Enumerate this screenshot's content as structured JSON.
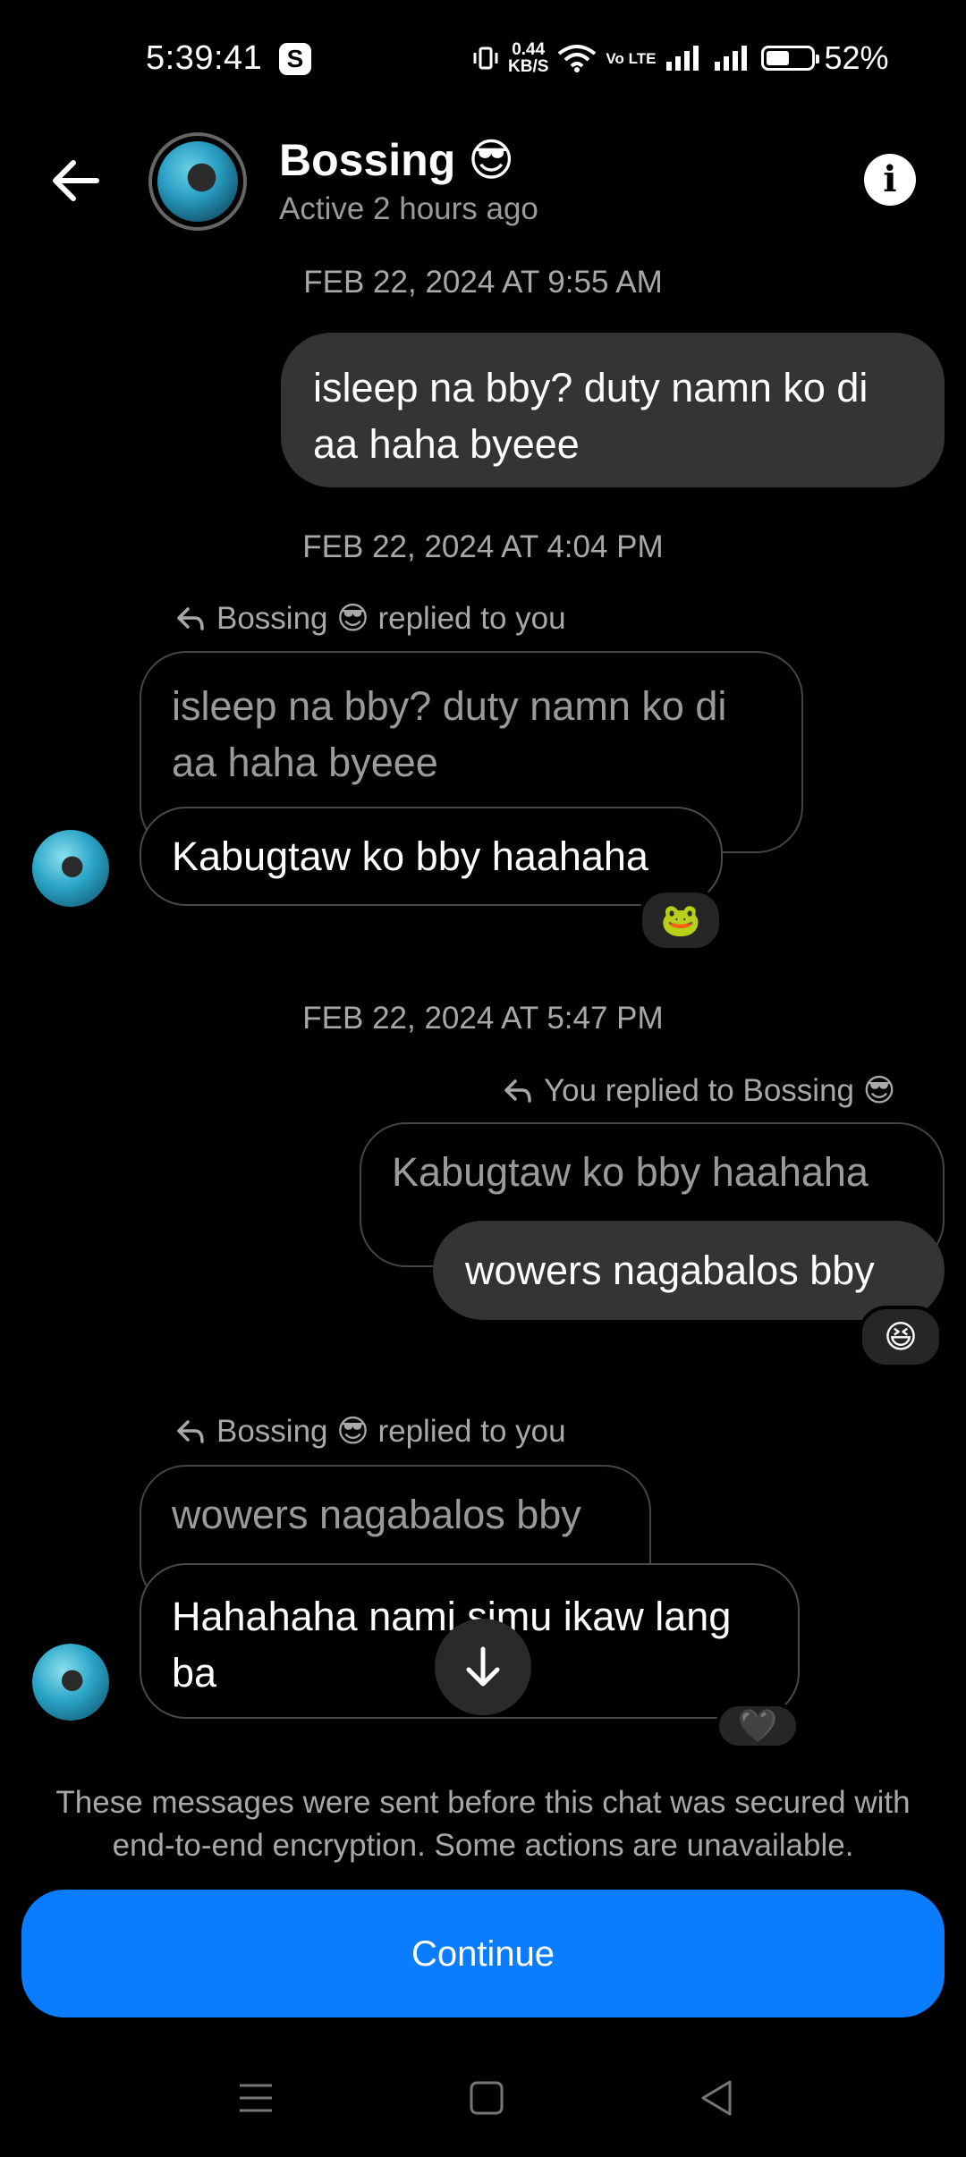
{
  "status_bar": {
    "time": "5:39:41",
    "app_icon": "S",
    "net_speed_value": "0.44",
    "net_speed_unit": "KB/S",
    "volte": "Vo LTE",
    "battery_level": 0.52,
    "battery_percent": "52%"
  },
  "header": {
    "name": "Bossing 😎",
    "status": "Active 2 hours ago",
    "info_icon": "i"
  },
  "messages": {
    "ts1": "FEB 22, 2024 AT 9:55 AM",
    "m1": "isleep na bby? duty namn ko di aa haha byeee",
    "ts2": "FEB 22, 2024 AT 4:04 PM",
    "r1_label": "Bossing 😎 replied to you",
    "r1_quote": "isleep na bby? duty namn ko di aa haha byeee",
    "r1_text": "Kabugtaw ko bby haahaha",
    "r1_reaction": "🐸",
    "ts3": "FEB 22, 2024 AT 5:47 PM",
    "r2_label": "You replied to Bossing 😎",
    "r2_quote": "Kabugtaw ko bby haahaha",
    "r2_text": "wowers nagabalos bby",
    "r2_reaction": "😆",
    "r3_label": "Bossing 😎 replied to you",
    "r3_quote": "wowers nagabalos bby",
    "r3_text": "Hahahaha nami simu ikaw lang ba",
    "r3_reaction": "🖤"
  },
  "footer": {
    "notice": "These messages were sent before this chat was secured with end-to-end encryption. Some actions are unavailable.",
    "continue_label": "Continue"
  },
  "icons": {
    "back": "arrow-left-icon",
    "scroll": "arrow-down-icon",
    "reply": "reply-arrow-icon",
    "nav_menu": "menu-icon",
    "nav_home": "square-icon",
    "nav_back": "triangle-back-icon"
  },
  "colors": {
    "accent": "#0a7cff",
    "outgoing_bubble": "#333436",
    "background": "#000000"
  }
}
